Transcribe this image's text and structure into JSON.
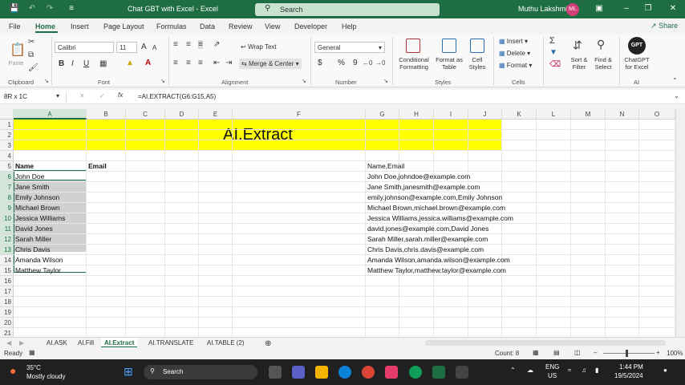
{
  "titlebar": {
    "autosave": "AutoSave",
    "document_title": "Chat GBT with Excel  -  Excel",
    "search_placeholder": "Search",
    "user_name": "Muthu Lakshmi",
    "user_initials": "ML"
  },
  "menu": {
    "items": [
      "File",
      "Home",
      "Insert",
      "Page Layout",
      "Formulas",
      "Data",
      "Review",
      "View",
      "Developer",
      "Help"
    ],
    "active": "Home",
    "share": "Share"
  },
  "ribbon": {
    "clipboard": {
      "paste": "Paste",
      "label": "Clipboard"
    },
    "font": {
      "name": "Calibri",
      "size": "11",
      "bold": "B",
      "italic": "I",
      "underline": "U",
      "grow": "A",
      "shrink": "A",
      "label": "Font"
    },
    "alignment": {
      "wrap_text": "Wrap Text",
      "merge_center": "Merge & Center",
      "label": "Alignment"
    },
    "number": {
      "format": "General",
      "currency": "$",
      "percent": "%",
      "comma": "9",
      "label": "Number"
    },
    "styles": {
      "conditional": "Conditional Formatting",
      "format_table": "Format as Table",
      "cell_styles": "Cell Styles",
      "label": "Styles"
    },
    "cells": {
      "insert": "Insert",
      "delete": "Delete",
      "format": "Format",
      "label": "Cells"
    },
    "editing": {
      "sort_filter": "Sort & Filter",
      "find_select": "Find & Select",
      "sum": "Σ"
    },
    "ai": {
      "gpt_label": "ChatGPT for Excel",
      "gpt_badge": "GPT",
      "label": "AI"
    }
  },
  "formula_bar": {
    "name_box": "8R x 1C",
    "fx": "fx",
    "formula": "=AI.EXTRACT(G6:G15,A5)"
  },
  "grid": {
    "columns": [
      "A",
      "B",
      "C",
      "D",
      "E",
      "F",
      "G",
      "H",
      "I",
      "J",
      "K",
      "L",
      "M",
      "N",
      "O"
    ],
    "rows": [
      "1",
      "2",
      "3",
      "4",
      "5",
      "6",
      "7",
      "8",
      "9",
      "10",
      "11",
      "12",
      "13",
      "14",
      "15",
      "16",
      "17",
      "18",
      "19",
      "20",
      "21"
    ],
    "banner_title": "AI.Extract",
    "header_name": "Name",
    "header_email": "Email",
    "names": [
      "John Doe",
      "Jane Smith",
      "Emily Johnson",
      "Michael Brown",
      "Jessica Williams",
      "David Jones",
      "Sarah Miller",
      "Chris Davis",
      "Amanda Wilson",
      "Matthew Taylor"
    ],
    "g_header": "Name,Email",
    "g_values": [
      "John Doe,johndoe@example.com",
      "Jane Smith,janesmith@example.com",
      "emily.johnson@example.com,Emily Johnson",
      "Michael Brown,michael.brown@example.com",
      "Jessica Williams,jessica.williams@example.com",
      "david.jones@example.com,David Jones",
      "Sarah Miller,sarah.miller@example.com",
      "Chris Davis,chris.davis@example.com",
      "Amanda Wilson,amanda.wilson@example.com",
      "Matthew Taylor,matthew.taylor@example.com"
    ]
  },
  "sheets": {
    "tabs": [
      "AI.ASK",
      "AI.Fill",
      "AI.Extract",
      "AI.TRANSLATE",
      "AI.TABLE (2)"
    ],
    "active": "AI.Extract"
  },
  "status": {
    "ready": "Ready",
    "count": "Count: 8",
    "zoom": "100%"
  },
  "taskbar": {
    "weather_temp": "35°C",
    "weather_desc": "Mostly cloudy",
    "search": "Search",
    "lang1": "ENG",
    "lang2": "US",
    "time": "1:44 PM",
    "date": "19/5/2024"
  }
}
